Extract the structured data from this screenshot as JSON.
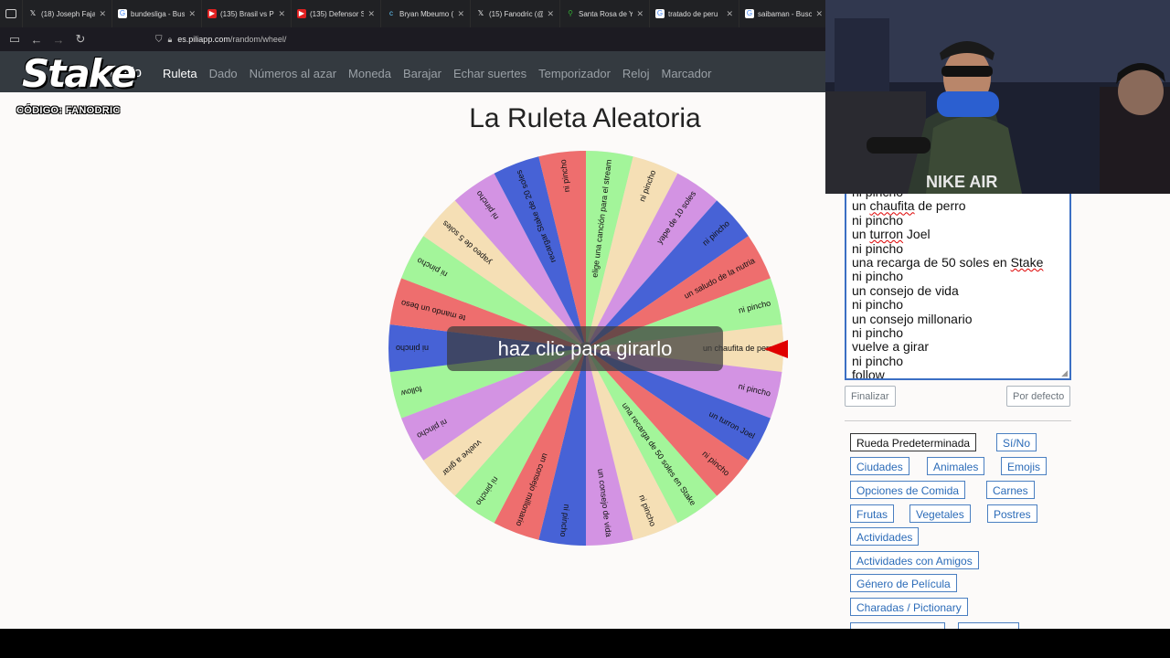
{
  "browser": {
    "tabs": [
      {
        "label": "(18) Joseph Fajar",
        "icon": "x-icon"
      },
      {
        "label": "bundesliga - Busc",
        "icon": "google-icon"
      },
      {
        "label": "(135) Brasil vs Pe",
        "icon": "youtube-icon"
      },
      {
        "label": "(135) Defensor S",
        "icon": "youtube-icon"
      },
      {
        "label": "Bryan Mbeumo (",
        "icon": "web-icon"
      },
      {
        "label": "(15) Fanodric (@",
        "icon": "x-icon"
      },
      {
        "label": "Santa Rosa de Yo",
        "icon": "maps-icon"
      },
      {
        "label": "tratado de peru",
        "icon": "google-icon"
      },
      {
        "label": "saibaman - Busc",
        "icon": "google-icon"
      }
    ],
    "url_host": "es.piliapp.com",
    "url_path": "/random/wheel/"
  },
  "overlay": {
    "logo": "Stake",
    "code": "CÓDIGO: FANODRIC"
  },
  "nav": {
    "home": "Inicio",
    "links": [
      "Ruleta",
      "Dado",
      "Números al azar",
      "Moneda",
      "Barajar",
      "Echar suertes",
      "Temporizador",
      "Reloj",
      "Marcador"
    ]
  },
  "page": {
    "title": "La Ruleta Aleatoria",
    "spin_label": "haz clic para girarlo"
  },
  "wheel": {
    "segments": [
      {
        "text": "un chaufita de perro",
        "color": "#f5dfb5"
      },
      {
        "text": "ni pincho",
        "color": "#d393e3"
      },
      {
        "text": "un turron Joel",
        "color": "#4762d6"
      },
      {
        "text": "ni pincho",
        "color": "#ee6e6e"
      },
      {
        "text": "una recarga de 50 soles en Stake",
        "color": "#a3f59a"
      },
      {
        "text": "ni pincho",
        "color": "#f5dfb5"
      },
      {
        "text": "un consejo de vida",
        "color": "#d393e3"
      },
      {
        "text": "ni pincho",
        "color": "#4762d6"
      },
      {
        "text": "un consejo millonario",
        "color": "#ee6e6e"
      },
      {
        "text": "ni pincho",
        "color": "#a3f59a"
      },
      {
        "text": "vuelve a girar",
        "color": "#f5dfb5"
      },
      {
        "text": "ni pincho",
        "color": "#d393e3"
      },
      {
        "text": "follow",
        "color": "#a3f59a"
      },
      {
        "text": "ni pincho",
        "color": "#4762d6"
      },
      {
        "text": "te mando un beso",
        "color": "#ee6e6e"
      },
      {
        "text": "ni pincho",
        "color": "#a3f59a"
      },
      {
        "text": "yapeo de 5 soles",
        "color": "#f5dfb5"
      },
      {
        "text": "ni pincho",
        "color": "#d393e3"
      },
      {
        "text": "recargar Stake de 20 soles",
        "color": "#4762d6"
      },
      {
        "text": "ni pincho",
        "color": "#ee6e6e"
      },
      {
        "text": "elige una canción para el stream",
        "color": "#a3f59a"
      },
      {
        "text": "ni pincho",
        "color": "#f5dfb5"
      },
      {
        "text": "yape de 10 soles",
        "color": "#d393e3"
      },
      {
        "text": "ni pincho",
        "color": "#4762d6"
      },
      {
        "text": "un saludo de la nutria",
        "color": "#ee6e6e"
      },
      {
        "text": "ni pincho",
        "color": "#a3f59a"
      }
    ]
  },
  "editor": {
    "lines": [
      {
        "text": "ni pincho"
      },
      {
        "text": "un ",
        "err": "chaufita",
        "rest": " de perro"
      },
      {
        "text": "ni pincho"
      },
      {
        "text": "un ",
        "err": "turron",
        "rest": " Joel"
      },
      {
        "text": "ni pincho"
      },
      {
        "text": "una recarga de 50 soles en ",
        "err": "Stake",
        "rest": ""
      },
      {
        "text": "ni pincho"
      },
      {
        "text": "un consejo de vida"
      },
      {
        "text": "ni pincho"
      },
      {
        "text": "un consejo millonario"
      },
      {
        "text": "ni pincho"
      },
      {
        "text": "vuelve a girar"
      },
      {
        "text": "ni pincho"
      },
      {
        "text": "",
        "err": "follow",
        "rest": ""
      }
    ],
    "finish_label": "Finalizar",
    "default_label": "Por defecto"
  },
  "presets": [
    "Rueda Predeterminada",
    "Sí/No",
    "Ciudades",
    "Animales",
    "Emojis",
    "Opciones de Comida",
    "Carnes",
    "Frutas",
    "Vegetales",
    "Postres",
    "Actividades",
    "Actividades con Amigos",
    "Género de Película",
    "Charadas / Pictionary"
  ]
}
